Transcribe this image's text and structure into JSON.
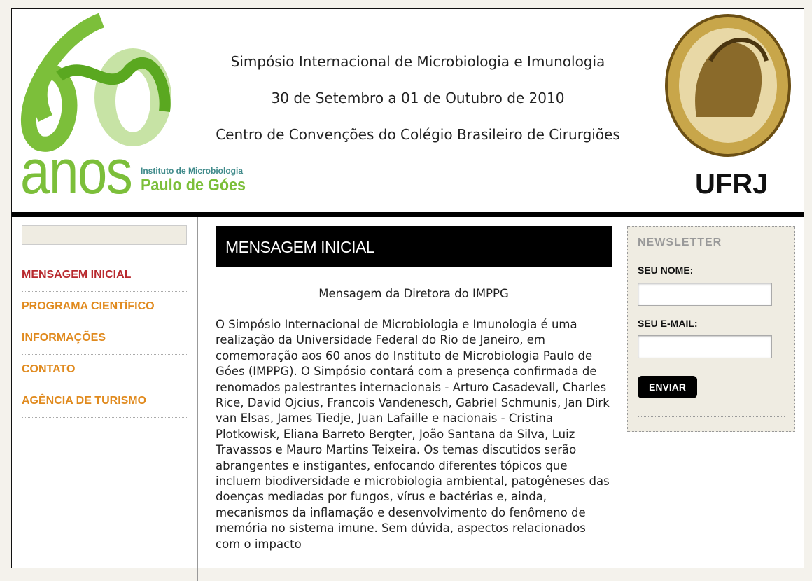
{
  "header": {
    "line1": "Simpósio Internacional de Microbiologia e Imunologia",
    "line2": "30 de Setembro a 01 de Outubro de 2010",
    "line3": "Centro de Convenções do Colégio Brasileiro de Cirurgiões",
    "logo_anos": "anos",
    "logo_inst": "Instituto de Microbiologia",
    "logo_name": "Paulo de Góes",
    "seal_text": "UFRJ"
  },
  "nav": [
    {
      "label": "MENSAGEM INICIAL"
    },
    {
      "label": "PROGRAMA CIENTÍFICO"
    },
    {
      "label": "INFORMAÇÕES"
    },
    {
      "label": "CONTATO"
    },
    {
      "label": "AGÊNCIA DE TURISMO"
    }
  ],
  "main": {
    "title": "MENSAGEM INICIAL",
    "subtitle": "Mensagem da Diretora do IMPPG",
    "body": "O Simpósio Internacional de Microbiologia e Imunologia é uma realização da Universidade Federal do Rio de Janeiro, em comemoração aos 60 anos do Instituto de Microbiologia Paulo de Góes (IMPPG). O Simpósio contará com a presença confirmada de renomados palestrantes internacionais - Arturo Casadevall, Charles Rice, David Ojcius, Francois Vandenesch, Gabriel Schmunis, Jan Dirk van Elsas, James Tiedje, Juan Lafaille e nacionais - Cristina Plotkowisk, Eliana Barreto Bergter, João Santana da Silva, Luiz Travassos e Mauro Martins Teixeira. Os temas discutidos serão abrangentes e instigantes, enfocando diferentes tópicos que incluem biodiversidade e microbiologia ambiental, patogêneses das doenças mediadas por fungos, vírus e bactérias e, ainda, mecanismos da inflamação e desenvolvimento do fenômeno de memória no sistema imune. Sem dúvida, aspectos relacionados com o impacto"
  },
  "newsletter": {
    "title": "NEWSLETTER",
    "name_label": "SEU NOME:",
    "name_value": "",
    "email_label": "SEU E-MAIL:",
    "email_value": "",
    "submit": "ENVIAR"
  }
}
